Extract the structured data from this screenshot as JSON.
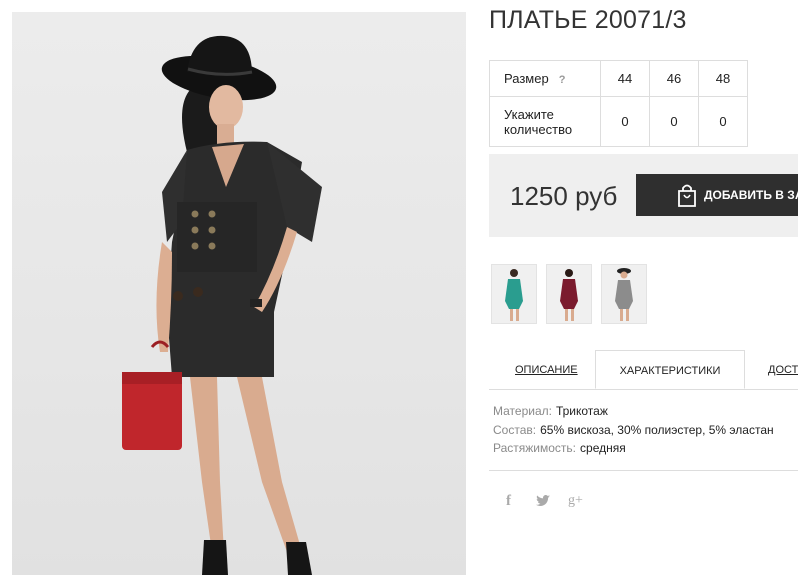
{
  "product": {
    "title": "ПЛАТЬЕ 20071/3",
    "size_label": "Размер",
    "size_help": "?",
    "sizes": [
      "44",
      "46",
      "48"
    ],
    "qty_label_line1": "Укажите",
    "qty_label_line2": "количество",
    "quantities": [
      "0",
      "0",
      "0"
    ],
    "price": "1250 руб",
    "add_to_cart": "ДОБАВИТЬ В ЗАКАЗ"
  },
  "thumbnails": [
    {
      "name": "thumb-green-dress",
      "color": "#2a9d8f"
    },
    {
      "name": "thumb-burgundy-dress",
      "color": "#7b1b2e"
    },
    {
      "name": "thumb-grey-dress",
      "color": "#8c8c8c"
    }
  ],
  "tabs": {
    "description": "ОПИСАНИЕ",
    "characteristics": "ХАРАКТЕРИСТИКИ",
    "delivery": "ДОСТАВКА"
  },
  "specs": [
    {
      "key": "Материал:",
      "value": "Трикотаж"
    },
    {
      "key": "Состав:",
      "value": "65% вискоза, 30% полиэстер, 5% эластан"
    },
    {
      "key": "Растяжимость:",
      "value": "средняя"
    }
  ],
  "social": {
    "facebook": "f",
    "twitter": "twitter-icon",
    "googleplus": "g+"
  },
  "colors": {
    "button_bg": "#2f2f2f",
    "buy_box_bg": "#efefef",
    "dress_main": "#2b2b2b",
    "bag_red": "#c0262c"
  }
}
